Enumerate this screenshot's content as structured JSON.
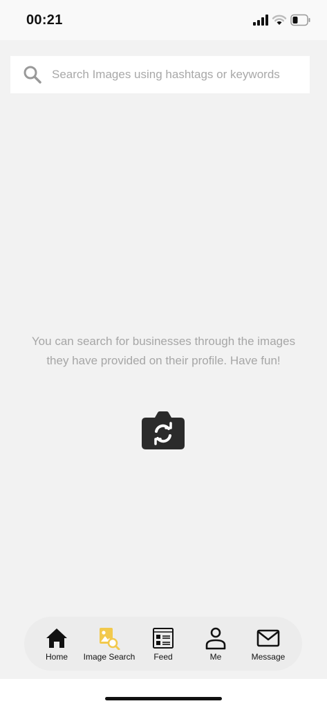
{
  "status_bar": {
    "time": "00:21",
    "icons": [
      "cellular-signal-icon",
      "wifi-icon",
      "battery-icon"
    ]
  },
  "search": {
    "placeholder": "Search Images using hashtags or keywords",
    "value": "",
    "icon": "search-icon"
  },
  "empty_state": {
    "message": "You can search for businesses through the images they have provided on their profile. Have fun!",
    "icon": "camera-switch-icon"
  },
  "nav": {
    "active": "Image Search",
    "active_color": "#f2c94c",
    "items": [
      {
        "label": "Home",
        "icon": "home-icon"
      },
      {
        "label": "Image Search",
        "icon": "image-search-icon"
      },
      {
        "label": "Feed",
        "icon": "feed-icon"
      },
      {
        "label": "Me",
        "icon": "person-icon"
      },
      {
        "label": "Message",
        "icon": "mail-icon"
      }
    ]
  }
}
